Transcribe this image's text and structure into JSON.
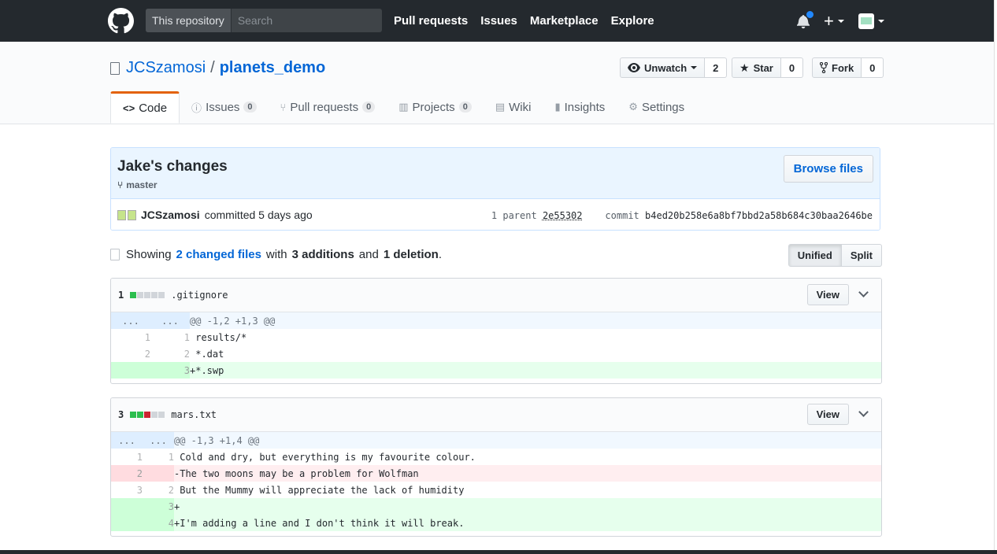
{
  "header": {
    "search_scope": "This repository",
    "search_placeholder": "Search",
    "nav": [
      "Pull requests",
      "Issues",
      "Marketplace",
      "Explore"
    ],
    "notification_dot_color": "#2188ff"
  },
  "repo": {
    "owner": "JCSzamosi",
    "separator": "/",
    "name": "planets_demo",
    "unwatch_label": "Unwatch",
    "watch_count": "2",
    "star_label": "Star",
    "star_count": "0",
    "fork_label": "Fork",
    "fork_count": "0"
  },
  "tabs": [
    {
      "label": "Code",
      "icon": "code-icon"
    },
    {
      "label": "Issues",
      "count": "0",
      "icon": "issue-icon"
    },
    {
      "label": "Pull requests",
      "count": "0",
      "icon": "pull-request-icon"
    },
    {
      "label": "Projects",
      "count": "0",
      "icon": "project-icon"
    },
    {
      "label": "Wiki",
      "icon": "book-icon"
    },
    {
      "label": "Insights",
      "icon": "graph-icon"
    },
    {
      "label": "Settings",
      "icon": "gear-icon"
    }
  ],
  "commit": {
    "title": "Jake's changes",
    "branch": "master",
    "browse_label": "Browse files",
    "author": "JCSzamosi",
    "action": "committed 5 days ago",
    "parent_label": "1 parent",
    "parent_sha": "2e55302",
    "commit_label": "commit",
    "commit_sha": "b4ed20b258e6a8bf7bbd2a58b684c30baa2646be"
  },
  "toc": {
    "showing": "Showing",
    "changed_files": "2 changed files",
    "with": "with",
    "additions": "3 additions",
    "and": "and",
    "deletions": "1 deletion",
    "period": ".",
    "unified_label": "Unified",
    "split_label": "Split"
  },
  "files": [
    {
      "changes": "1",
      "name": ".gitignore",
      "view_label": "View",
      "hunk": "@@ -1,2 +1,3 @@",
      "lines": [
        {
          "old": "1",
          "new": "1",
          "code": " results/*",
          "type": "ctx"
        },
        {
          "old": "2",
          "new": "2",
          "code": " *.dat",
          "type": "ctx"
        },
        {
          "old": "",
          "new": "3",
          "code": "+*.swp",
          "type": "add"
        }
      ]
    },
    {
      "changes": "3",
      "name": "mars.txt",
      "view_label": "View",
      "hunk": "@@ -1,3 +1,4 @@",
      "lines": [
        {
          "old": "1",
          "new": "1",
          "code": " Cold and dry, but everything is my favourite colour.",
          "type": "ctx"
        },
        {
          "old": "2",
          "new": "",
          "code": "-The two moons may be a problem for Wolfman",
          "type": "del"
        },
        {
          "old": "3",
          "new": "2",
          "code": " But the Mummy will appreciate the lack of humidity",
          "type": "ctx"
        },
        {
          "old": "",
          "new": "3",
          "code": "+",
          "type": "add"
        },
        {
          "old": "",
          "new": "4",
          "code": "+I'm adding a line and I don't think it will break.",
          "type": "add"
        }
      ]
    }
  ],
  "hunk_ellipsis": "..."
}
